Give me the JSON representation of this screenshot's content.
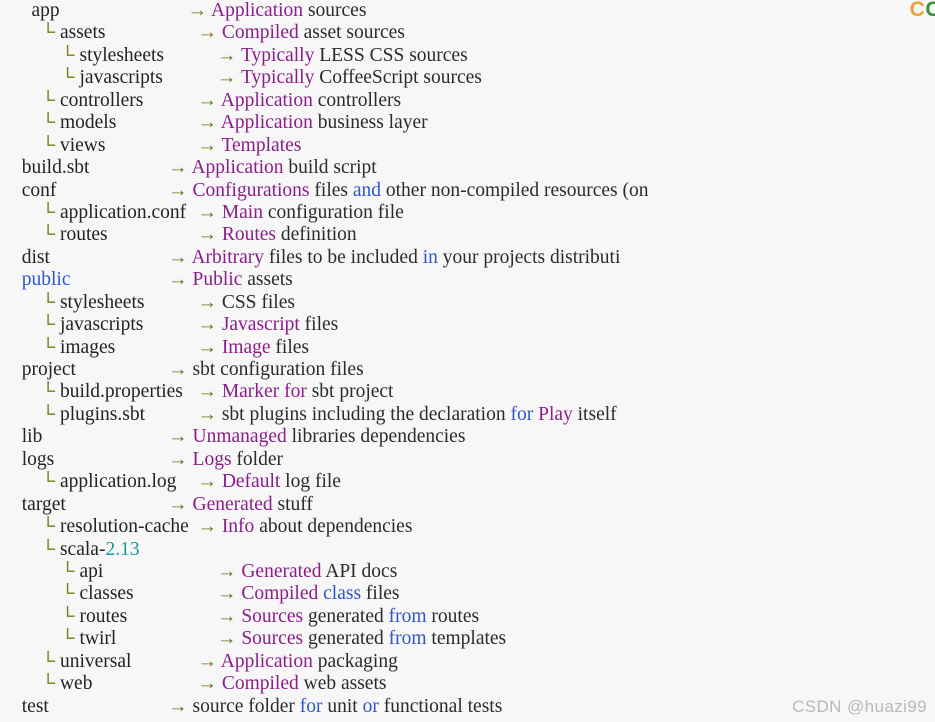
{
  "page": {
    "title": "Play Framework project anatomy",
    "background": "#f7f7f7",
    "colors": {
      "branch": "#7a7a12",
      "arrow": "#6e6e14",
      "name": "#232323",
      "keyword": "#2f56c9",
      "number": "#1a9a9a",
      "magenta": "#8b1d8b",
      "text": "#2b2b2b",
      "watermark": "#b9b9b9"
    }
  },
  "watermark": {
    "bottom": "CSDN @huazi99",
    "top_partial_1": "C",
    "top_partial_2": "C"
  },
  "glyphs": {
    "branch": "└",
    "arrow": "→"
  },
  "rows": [
    {
      "indent": 2,
      "branch": false,
      "name": [
        {
          "t": "app",
          "c": "name"
        }
      ],
      "arrow_col": 16,
      "desc": [
        {
          "t": "Application",
          "c": "mag"
        },
        {
          "t": " sources",
          "c": "txt"
        }
      ]
    },
    {
      "indent": 3,
      "branch": true,
      "name": [
        {
          "t": "assets",
          "c": "name"
        }
      ],
      "arrow_col": 16,
      "desc": [
        {
          "t": "Compiled",
          "c": "mag"
        },
        {
          "t": " asset sources",
          "c": "txt"
        }
      ]
    },
    {
      "indent": 5,
      "branch": true,
      "name": [
        {
          "t": "stylesheets",
          "c": "name"
        }
      ],
      "arrow_col": 16,
      "desc": [
        {
          "t": "Typically",
          "c": "mag"
        },
        {
          "t": " LESS CSS sources",
          "c": "txt"
        }
      ]
    },
    {
      "indent": 5,
      "branch": true,
      "name": [
        {
          "t": "javascripts",
          "c": "name"
        }
      ],
      "arrow_col": 16,
      "desc": [
        {
          "t": "Typically",
          "c": "mag"
        },
        {
          "t": " CoffeeScript sources",
          "c": "txt"
        }
      ]
    },
    {
      "indent": 3,
      "branch": true,
      "name": [
        {
          "t": "controllers",
          "c": "name"
        }
      ],
      "arrow_col": 16,
      "desc": [
        {
          "t": "Application",
          "c": "mag"
        },
        {
          "t": " controllers",
          "c": "txt"
        }
      ]
    },
    {
      "indent": 3,
      "branch": true,
      "name": [
        {
          "t": "models",
          "c": "name"
        }
      ],
      "arrow_col": 16,
      "desc": [
        {
          "t": "Application",
          "c": "mag"
        },
        {
          "t": " business layer",
          "c": "txt"
        }
      ]
    },
    {
      "indent": 3,
      "branch": true,
      "name": [
        {
          "t": "views",
          "c": "name"
        }
      ],
      "arrow_col": 16,
      "desc": [
        {
          "t": "Templates",
          "c": "mag"
        }
      ]
    },
    {
      "indent": 1,
      "branch": false,
      "name": [
        {
          "t": "build.sbt",
          "c": "name"
        }
      ],
      "arrow_col": 15,
      "desc": [
        {
          "t": "Application",
          "c": "mag"
        },
        {
          "t": " build script",
          "c": "txt"
        }
      ]
    },
    {
      "indent": 1,
      "branch": false,
      "name": [
        {
          "t": "conf",
          "c": "name"
        }
      ],
      "arrow_col": 15,
      "desc": [
        {
          "t": "Configurations",
          "c": "mag"
        },
        {
          "t": " files ",
          "c": "txt"
        },
        {
          "t": "and",
          "c": "blu"
        },
        {
          "t": " other non-compiled resources (on",
          "c": "txt"
        }
      ]
    },
    {
      "indent": 3,
      "branch": true,
      "name": [
        {
          "t": "application.conf",
          "c": "name"
        }
      ],
      "arrow_col": 16,
      "desc": [
        {
          "t": "Main",
          "c": "mag"
        },
        {
          "t": " configuration file",
          "c": "txt"
        }
      ]
    },
    {
      "indent": 3,
      "branch": true,
      "name": [
        {
          "t": "routes",
          "c": "name"
        }
      ],
      "arrow_col": 16,
      "desc": [
        {
          "t": "Routes",
          "c": "mag"
        },
        {
          "t": " definition",
          "c": "txt"
        }
      ]
    },
    {
      "indent": 1,
      "branch": false,
      "name": [
        {
          "t": "dist",
          "c": "name"
        }
      ],
      "arrow_col": 15,
      "desc": [
        {
          "t": "Arbitrary",
          "c": "mag"
        },
        {
          "t": " files to be included ",
          "c": "txt"
        },
        {
          "t": "in",
          "c": "blu"
        },
        {
          "t": " your projects distributi",
          "c": "txt"
        }
      ]
    },
    {
      "indent": 1,
      "branch": false,
      "name": [
        {
          "t": "public",
          "c": "kw"
        }
      ],
      "arrow_col": 15,
      "desc": [
        {
          "t": "Public",
          "c": "mag"
        },
        {
          "t": " assets",
          "c": "txt"
        }
      ]
    },
    {
      "indent": 3,
      "branch": true,
      "name": [
        {
          "t": "stylesheets",
          "c": "name"
        }
      ],
      "arrow_col": 16,
      "desc": [
        {
          "t": "CSS files",
          "c": "txt"
        }
      ]
    },
    {
      "indent": 3,
      "branch": true,
      "name": [
        {
          "t": "javascripts",
          "c": "name"
        }
      ],
      "arrow_col": 16,
      "desc": [
        {
          "t": "Javascript",
          "c": "mag"
        },
        {
          "t": " files",
          "c": "txt"
        }
      ]
    },
    {
      "indent": 3,
      "branch": true,
      "name": [
        {
          "t": "images",
          "c": "name"
        }
      ],
      "arrow_col": 16,
      "desc": [
        {
          "t": "Image",
          "c": "mag"
        },
        {
          "t": " files",
          "c": "txt"
        }
      ]
    },
    {
      "indent": 1,
      "branch": false,
      "name": [
        {
          "t": "project",
          "c": "name"
        }
      ],
      "arrow_col": 15,
      "desc": [
        {
          "t": "sbt configuration files",
          "c": "txt"
        }
      ]
    },
    {
      "indent": 3,
      "branch": true,
      "name": [
        {
          "t": "build.properties",
          "c": "name"
        }
      ],
      "arrow_col": 16,
      "desc": [
        {
          "t": "Marker",
          "c": "mag"
        },
        {
          "t": " ",
          "c": "txt"
        },
        {
          "t": "for",
          "c": "mag"
        },
        {
          "t": " sbt project",
          "c": "txt"
        }
      ]
    },
    {
      "indent": 3,
      "branch": true,
      "name": [
        {
          "t": "plugins.sbt",
          "c": "name"
        }
      ],
      "arrow_col": 16,
      "desc": [
        {
          "t": "sbt plugins including the declaration ",
          "c": "txt"
        },
        {
          "t": "for",
          "c": "blu"
        },
        {
          "t": " ",
          "c": "txt"
        },
        {
          "t": "Play",
          "c": "mag"
        },
        {
          "t": " itself",
          "c": "txt"
        }
      ]
    },
    {
      "indent": 1,
      "branch": false,
      "name": [
        {
          "t": "lib",
          "c": "name"
        }
      ],
      "arrow_col": 15,
      "desc": [
        {
          "t": "Unmanaged",
          "c": "mag"
        },
        {
          "t": " libraries dependencies",
          "c": "txt"
        }
      ]
    },
    {
      "indent": 1,
      "branch": false,
      "name": [
        {
          "t": "logs",
          "c": "name"
        }
      ],
      "arrow_col": 15,
      "desc": [
        {
          "t": "Logs",
          "c": "mag"
        },
        {
          "t": " folder",
          "c": "txt"
        }
      ]
    },
    {
      "indent": 3,
      "branch": true,
      "name": [
        {
          "t": "application.log",
          "c": "name"
        }
      ],
      "arrow_col": 16,
      "desc": [
        {
          "t": "Default",
          "c": "mag"
        },
        {
          "t": " log file",
          "c": "txt"
        }
      ]
    },
    {
      "indent": 1,
      "branch": false,
      "name": [
        {
          "t": "target",
          "c": "name"
        }
      ],
      "arrow_col": 15,
      "desc": [
        {
          "t": "Generated",
          "c": "mag"
        },
        {
          "t": " stuff",
          "c": "txt"
        }
      ]
    },
    {
      "indent": 3,
      "branch": true,
      "name": [
        {
          "t": "resolution-cache",
          "c": "name"
        }
      ],
      "arrow_col": 16,
      "desc": [
        {
          "t": "Info",
          "c": "mag"
        },
        {
          "t": " about dependencies",
          "c": "txt"
        }
      ]
    },
    {
      "indent": 3,
      "branch": true,
      "name": [
        {
          "t": "scala-",
          "c": "name"
        },
        {
          "t": "2.13",
          "c": "num"
        }
      ],
      "arrow_col": 16,
      "desc": []
    },
    {
      "indent": 5,
      "branch": true,
      "name": [
        {
          "t": "api",
          "c": "name"
        }
      ],
      "arrow_col": 16,
      "desc": [
        {
          "t": "Generated",
          "c": "mag"
        },
        {
          "t": " API docs",
          "c": "txt"
        }
      ]
    },
    {
      "indent": 5,
      "branch": true,
      "name": [
        {
          "t": "classes",
          "c": "name"
        }
      ],
      "arrow_col": 16,
      "desc": [
        {
          "t": "Compiled",
          "c": "mag"
        },
        {
          "t": " ",
          "c": "txt"
        },
        {
          "t": "class",
          "c": "blu"
        },
        {
          "t": " files",
          "c": "txt"
        }
      ]
    },
    {
      "indent": 5,
      "branch": true,
      "name": [
        {
          "t": "routes",
          "c": "name"
        }
      ],
      "arrow_col": 16,
      "desc": [
        {
          "t": "Sources",
          "c": "mag"
        },
        {
          "t": " generated ",
          "c": "txt"
        },
        {
          "t": "from",
          "c": "blu"
        },
        {
          "t": " routes",
          "c": "txt"
        }
      ]
    },
    {
      "indent": 5,
      "branch": true,
      "name": [
        {
          "t": "twirl",
          "c": "name"
        }
      ],
      "arrow_col": 16,
      "desc": [
        {
          "t": "Sources",
          "c": "mag"
        },
        {
          "t": " generated ",
          "c": "txt"
        },
        {
          "t": "from",
          "c": "blu"
        },
        {
          "t": " templates",
          "c": "txt"
        }
      ]
    },
    {
      "indent": 3,
      "branch": true,
      "name": [
        {
          "t": "universal",
          "c": "name"
        }
      ],
      "arrow_col": 16,
      "desc": [
        {
          "t": "Application",
          "c": "mag"
        },
        {
          "t": " packaging",
          "c": "txt"
        }
      ]
    },
    {
      "indent": 3,
      "branch": true,
      "name": [
        {
          "t": "web",
          "c": "name"
        }
      ],
      "arrow_col": 16,
      "desc": [
        {
          "t": "Compiled",
          "c": "mag"
        },
        {
          "t": " web assets",
          "c": "txt"
        }
      ]
    },
    {
      "indent": 1,
      "branch": false,
      "name": [
        {
          "t": "test",
          "c": "name"
        }
      ],
      "arrow_col": 15,
      "desc": [
        {
          "t": "source folder ",
          "c": "txt"
        },
        {
          "t": "for",
          "c": "blu"
        },
        {
          "t": " unit ",
          "c": "txt"
        },
        {
          "t": "or",
          "c": "blu"
        },
        {
          "t": " functional tests",
          "c": "txt"
        }
      ]
    }
  ]
}
